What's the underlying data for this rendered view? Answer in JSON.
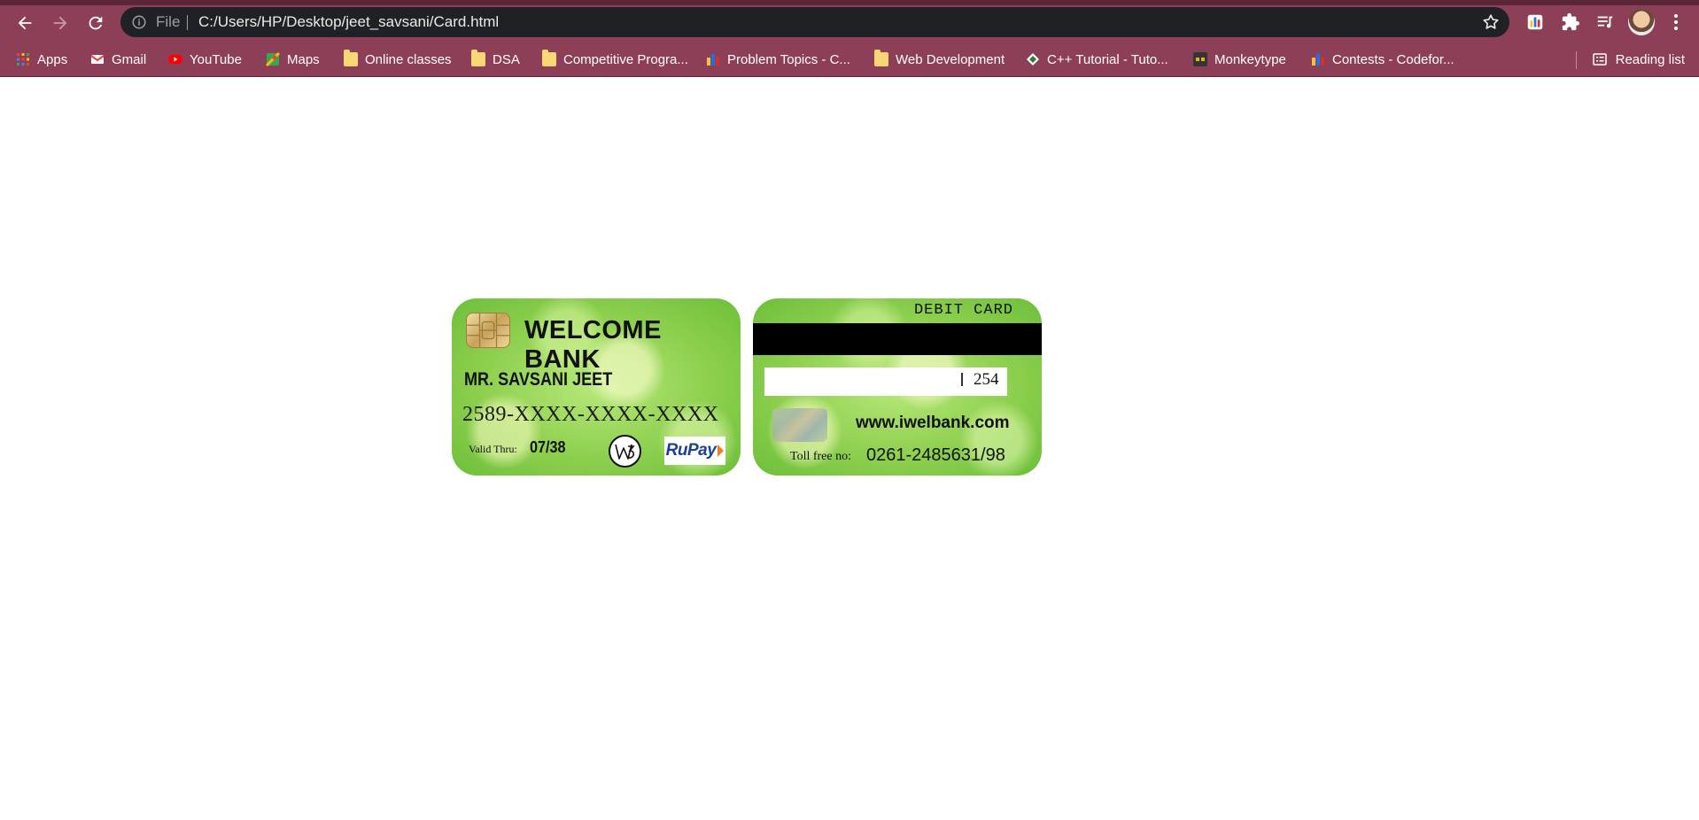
{
  "browser": {
    "scheme_label": "File",
    "url": "C:/Users/HP/Desktop/jeet_savsani/Card.html",
    "bookmarks": [
      {
        "label": "Apps",
        "icon": "apps-grid-icon"
      },
      {
        "label": "Gmail",
        "icon": "gmail-icon"
      },
      {
        "label": "YouTube",
        "icon": "youtube-icon"
      },
      {
        "label": "Maps",
        "icon": "maps-icon"
      },
      {
        "label": "Online classes",
        "icon": "folder-icon"
      },
      {
        "label": "DSA",
        "icon": "folder-icon"
      },
      {
        "label": "Competitive Progra...",
        "icon": "folder-icon"
      },
      {
        "label": "Problem Topics - C...",
        "icon": "codeforces-icon"
      },
      {
        "label": "Web Development",
        "icon": "folder-icon"
      },
      {
        "label": "C++ Tutorial - Tuto...",
        "icon": "tutorial-icon"
      },
      {
        "label": "Monkeytype",
        "icon": "monkeytype-icon"
      },
      {
        "label": "Contests - Codefor...",
        "icon": "codeforces-icon"
      }
    ],
    "reading_list": "Reading list"
  },
  "card_front": {
    "bank_name": "WELCOME BANK",
    "holder_name": "MR. SAVSANI JEET",
    "card_number": "2589-XXXX-XXXX-XXXX",
    "valid_label": "Valid Thru:",
    "valid_date": "07/38",
    "network": "RuPay"
  },
  "card_back": {
    "title": "DEBIT CARD",
    "cvv": "254",
    "website": "www.iwelbank.com",
    "toll_label": "Toll free no:",
    "toll_number": "0261-2485631/98"
  },
  "colors": {
    "chrome_bg": "#8c3f57",
    "omnibox_bg": "#202124",
    "card_green": "#8ed04f",
    "rupay_blue": "#1c3f94",
    "rupay_orange": "#f47b20"
  }
}
